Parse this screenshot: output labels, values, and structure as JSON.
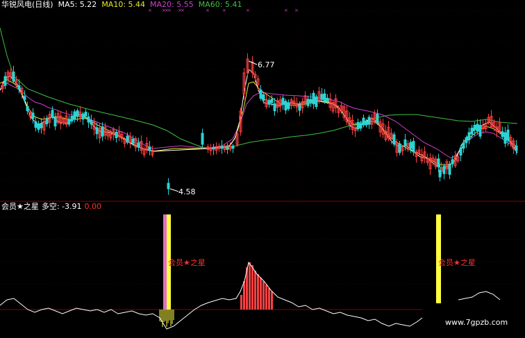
{
  "legend": {
    "title": "华锐风电(日线)",
    "ma5": "MA5: 5.22",
    "ma10": "MA10: 5.44",
    "ma20": "MA20: 5.55",
    "ma60": "MA60: 5.41"
  },
  "price_labels": {
    "high": "6.77",
    "low": "4.58"
  },
  "indicator": {
    "name": "会员★之星",
    "duokong": "多空: -3.91",
    "value2": "0.00",
    "annotation": "会员★之星"
  },
  "watermark": "www.7gpzb.com",
  "colors": {
    "bg": "#000000",
    "up": "#ff4040",
    "down": "#2ad4d4",
    "ma5": "#ffffff",
    "ma10": "#e8e830",
    "ma20": "#cc40cc",
    "ma60": "#40c040",
    "grid": "#8b0000",
    "signal_yellow": "#ffff40",
    "signal_pink": "#e070c0",
    "annotation_red": "#ff3030"
  }
}
